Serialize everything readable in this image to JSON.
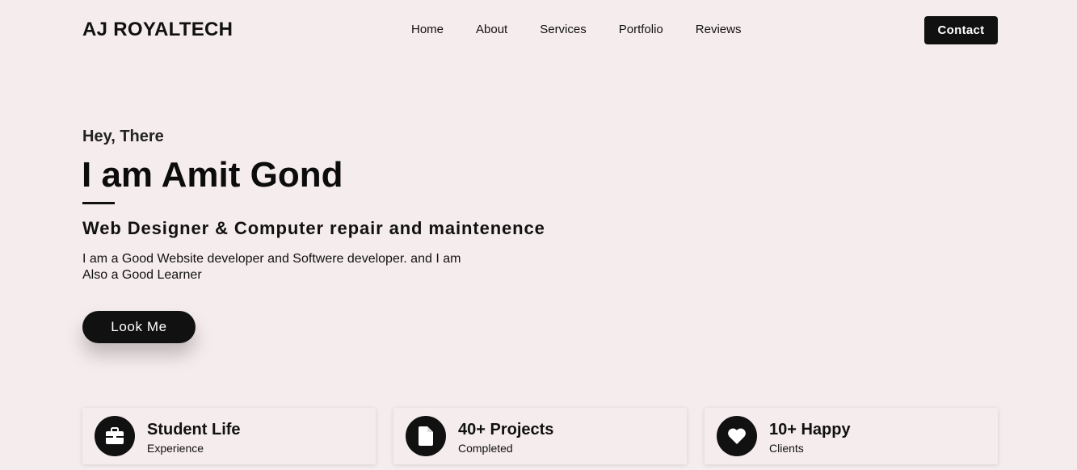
{
  "header": {
    "logo": "AJ ROYALTECH",
    "nav": [
      "Home",
      "About",
      "Services",
      "Portfolio",
      "Reviews"
    ],
    "contact_label": "Contact"
  },
  "hero": {
    "greeting": "Hey, There",
    "name": "I am Amit Gond",
    "role": "Web Designer & Computer repair and maintenence",
    "description_line1": "I am a Good Website developer and Softwere developer. and I am",
    "description_line2": "Also a Good Learner",
    "button_label": "Look Me"
  },
  "stats": [
    {
      "icon": "briefcase-icon",
      "title": "Student Life",
      "subtitle": "Experience"
    },
    {
      "icon": "file-icon",
      "title": "40+ Projects",
      "subtitle": "Completed"
    },
    {
      "icon": "heart-icon",
      "title": "10+ Happy",
      "subtitle": "Clients"
    }
  ],
  "colors": {
    "background": "#f5eced",
    "primary": "#111111",
    "button_text": "#ffffff"
  }
}
